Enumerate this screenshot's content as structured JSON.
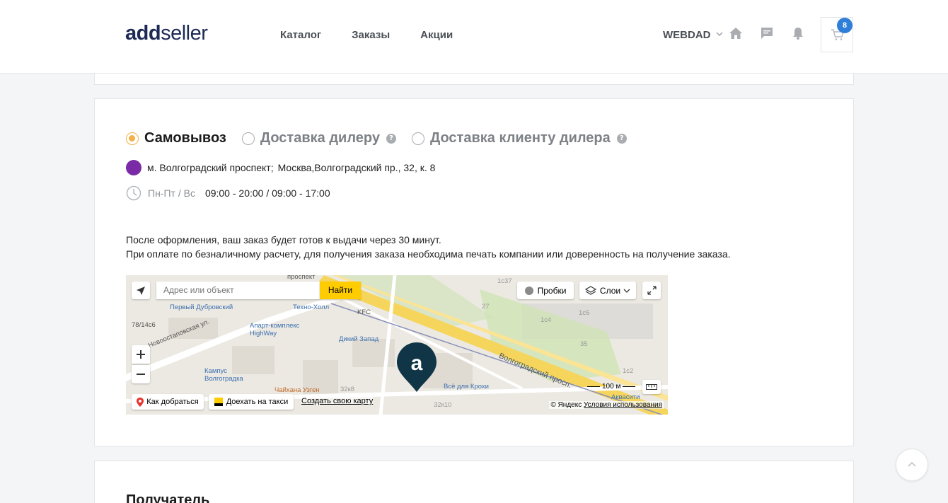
{
  "header": {
    "logo_bold": "add",
    "logo_light": "seller",
    "nav": [
      "Каталог",
      "Заказы",
      "Акции"
    ],
    "user": "WEBDAD",
    "cart_count": "8"
  },
  "delivery": {
    "options": [
      {
        "label": "Самовывоз",
        "selected": true
      },
      {
        "label": "Доставка дилеру",
        "selected": false
      },
      {
        "label": "Доставка клиенту дилера",
        "selected": false
      }
    ],
    "help_glyph": "?",
    "metro_color": "#7b2aa6",
    "metro": "м. Волгоградский проспект;",
    "address": "Москва,Волгоградский пр., 32, к. 8",
    "days": "Пн-Пт / Вс",
    "time": "09:00 - 20:00 / 09:00 - 17:00",
    "note_line1": "После оформления, ваш заказ будет готов к выдачи через 30 минут.",
    "note_line2": "При оплате по безналичному расчету, для получения заказа необходима печать компании или доверенность на получение заказа."
  },
  "map": {
    "search_placeholder": "Адрес или объект",
    "search_button": "Найти",
    "traffic": "Пробки",
    "layers": "Слои",
    "route": "Как добраться",
    "taxi": "Доехать на такси",
    "create_map": "Создать свою карту",
    "scale": "100 м",
    "attribution_prefix": "© Яндекс",
    "terms": "Условия использования",
    "labels": {
      "prospekt_top": "проспект",
      "dubrovsky": "Первый Дубровский",
      "tekhno": "Техно-Холл",
      "kfc": "KFC",
      "highway": "Апарт-комплекс HighWay",
      "novoost": "Новоостаповская ул.",
      "diky": "Дикий Запад",
      "kampus": "Кампус Волгоградка",
      "chaihana": "Чайхана Узген",
      "krokhi": "Всё для Крохи",
      "volgo": "Волгоградский просп.",
      "akvasiti": "Аквасити",
      "n32k8": "32к8",
      "n32k10": "32к10",
      "n78": "78/14с6",
      "c5": "1с5",
      "c4": "1с4",
      "c2": "1с2",
      "c37": "1с37",
      "n35": "35",
      "n27": "27"
    }
  },
  "recipient": {
    "title": "Получатель"
  },
  "colors": {
    "accent": "#f2b14a",
    "badge": "#2f7fd8",
    "brand": "#1d2a55"
  }
}
